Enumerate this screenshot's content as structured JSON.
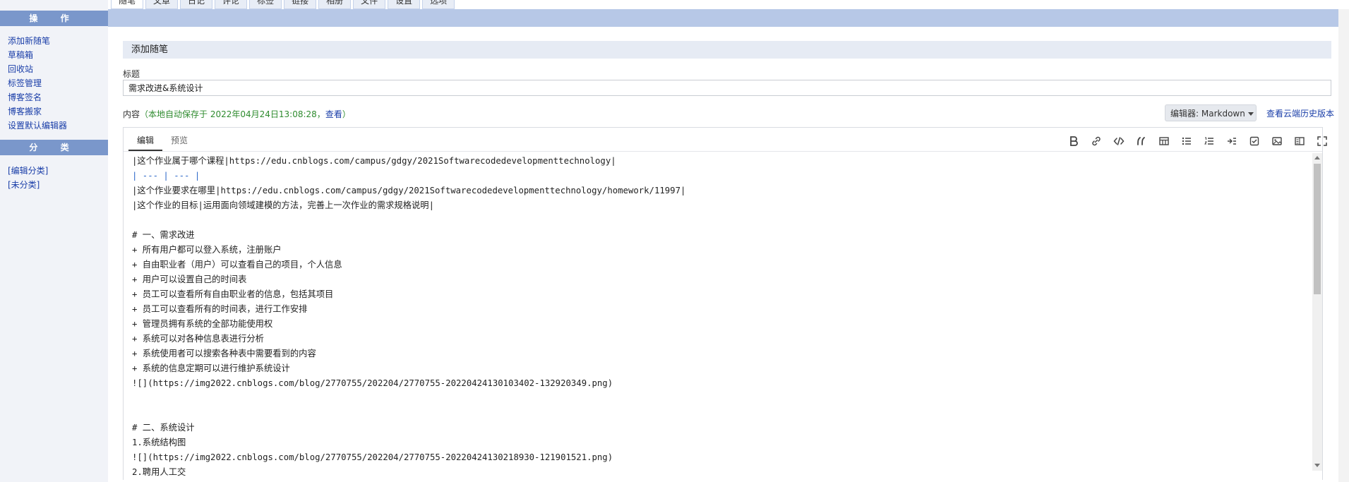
{
  "sidebar": {
    "ops_header": "操 作",
    "ops_links": [
      "添加新随笔",
      "草稿箱",
      "回收站",
      "标签管理",
      "博客签名",
      "博客搬家",
      "设置默认编辑器"
    ],
    "cat_header": "分 类",
    "cat_links": [
      "[编辑分类]",
      "[未分类]"
    ]
  },
  "top_tabs": [
    "随笔",
    "文章",
    "日记",
    "评论",
    "标签",
    "链接",
    "相册",
    "文件",
    "设置",
    "选项"
  ],
  "section_title": "添加随笔",
  "title_label": "标题",
  "title_value": "需求改进&系统设计",
  "content_label": "内容",
  "autosave_text": "（本地自动保存于 2022年04月24日13:08:28，",
  "autosave_link": "查看",
  "autosave_end": "）",
  "editor_select": "编辑器: Markdown",
  "history_link": "查看云端历史版本",
  "editor_tabs": [
    "编辑",
    "预览"
  ],
  "toolbar_icons": [
    "bold-icon",
    "link-icon",
    "code-icon",
    "quote-icon",
    "table-icon",
    "bullet-list-icon",
    "numbered-list-icon",
    "indent-icon",
    "checkbox-icon",
    "image-icon",
    "split-view-icon",
    "fullscreen-icon"
  ],
  "code_lines": [
    "|这个作业属于哪个课程|https://edu.cnblogs.com/campus/gdgy/2021Softwarecodedevelopmenttechnology|",
    "| --- | --- |",
    "|这个作业要求在哪里|https://edu.cnblogs.com/campus/gdgy/2021Softwarecodedevelopmenttechnology/homework/11997|",
    "|这个作业的目标|运用面向领域建模的方法，完善上一次作业的需求规格说明|",
    "",
    "# 一、需求改进",
    "+ 所有用户都可以登入系统，注册账户",
    "+ 自由职业者（用户）可以查看自己的项目，个人信息",
    "+ 用户可以设置自己的时间表",
    "+ 员工可以查看所有自由职业者的信息，包括其项目",
    "+ 员工可以查看所有的时间表，进行工作安排",
    "+ 管理员拥有系统的全部功能使用权",
    "+ 系统可以对各种信息表进行分析",
    "+ 系统使用者可以搜索各种表中需要看到的内容",
    "+ 系统的信息定期可以进行维护系统设计",
    "![](https://img2022.cnblogs.com/blog/2770755/202204/2770755-20220424130103402-132920349.png)",
    "",
    "",
    "# 二、系统设计",
    "1.系统结构图",
    "![](https://img2022.cnblogs.com/blog/2770755/202204/2770755-20220424130218930-121901521.png)",
    "2.聘用人工交"
  ]
}
